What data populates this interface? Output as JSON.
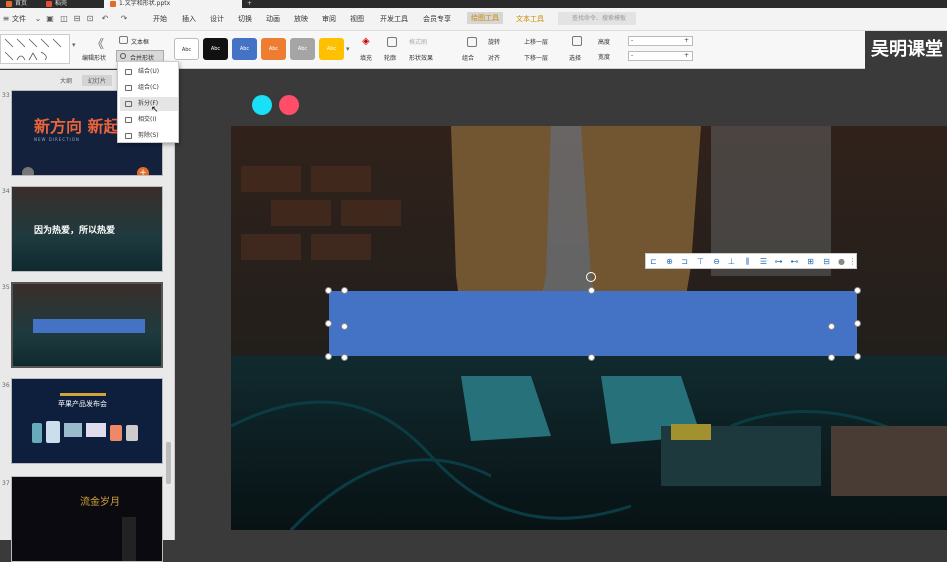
{
  "titlebar": {
    "tabs": [
      {
        "label": "首页",
        "color": "#e26b2a"
      },
      {
        "label": "稻壳",
        "color": "#e14f3a"
      },
      {
        "label": "1.文字和形状.pptx",
        "color": "#e26b2a"
      }
    ],
    "new_tab": "+"
  },
  "menubar": {
    "file": "文件",
    "items": [
      "开始",
      "插入",
      "设计",
      "切换",
      "动画",
      "放映",
      "审阅",
      "视图",
      "开发工具",
      "会员专享",
      "绘图工具",
      "文本工具"
    ],
    "search_placeholder": "查找命令、搜索模板"
  },
  "ribbon": {
    "left_group": {
      "edit_shape": "编辑形状",
      "text_box": "文本框",
      "merge_shapes": "合并形状"
    },
    "swatches": [
      {
        "label": "Abc",
        "bg": "#ffffff",
        "fg": "#333333"
      },
      {
        "label": "Abc",
        "bg": "#111111",
        "fg": "#ffffff"
      },
      {
        "label": "Abc",
        "bg": "#4472c4",
        "fg": "#ffffff"
      },
      {
        "label": "Abc",
        "bg": "#ed7d31",
        "fg": "#ffffff"
      },
      {
        "label": "Abc",
        "bg": "#a5a5a5",
        "fg": "#ffffff"
      },
      {
        "label": "Abc",
        "bg": "#ffc000",
        "fg": "#ffffff"
      }
    ],
    "fill": "填充",
    "outline": "轮廓",
    "format_painter": "格式刷",
    "shape_effects": "形状效果",
    "group": "组合",
    "rotate": "旋转",
    "align": "对齐",
    "bring_forward": "上移一层",
    "send_backward": "下移一层",
    "select_pane": "选择窗格",
    "select": "选择",
    "height_label": "高度",
    "width_label": "宽度",
    "height_value": "-",
    "width_value": "-",
    "brand": "吴明课堂"
  },
  "leftpanel": {
    "tabs": [
      "大纲",
      "幻灯片"
    ],
    "slides": [
      {
        "num": "33",
        "text": "新方向 新起",
        "sub": "NEW DIRECTION"
      },
      {
        "num": "34",
        "text": "因为热爱，所以热爱"
      },
      {
        "num": "35",
        "text": ""
      },
      {
        "num": "36",
        "text": "苹果产品发布会"
      },
      {
        "num": "37",
        "text": "流金岁月"
      }
    ]
  },
  "dropdown": {
    "items": [
      "结合(U)",
      "组合(C)",
      "拆分(F)",
      "相交(I)",
      "剪除(S)"
    ],
    "hovered_index": 2
  },
  "colors": {
    "shape_fill": "#4472c4",
    "dot_cyan": "#19e0f7",
    "dot_red": "#ff4d6a"
  }
}
